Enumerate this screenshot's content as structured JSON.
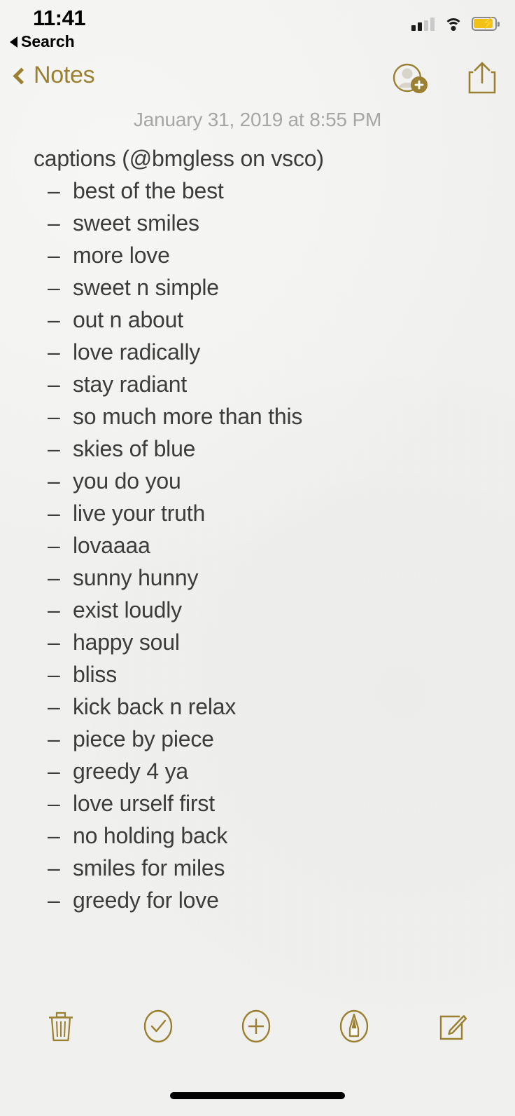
{
  "status_bar": {
    "time": "11:41",
    "back_app_label": "Search",
    "back_arrow_icon": "triangle-left-icon",
    "signal_icon": "cellular-signal-icon",
    "signal_bars_filled": 2,
    "signal_bars_total": 4,
    "wifi_icon": "wifi-icon",
    "battery_icon": "battery-charging-icon",
    "battery_charging": true,
    "battery_color": "#f2c115"
  },
  "nav_bar": {
    "back_label": "Notes",
    "back_icon": "chevron-left-icon",
    "add_people_icon": "add-person-icon",
    "share_icon": "share-icon",
    "accent_color": "#9c8032"
  },
  "note": {
    "date": "January 31, 2019 at 8:55 PM",
    "title": "captions (@bmgless on vsco)",
    "bullet": "–",
    "items": [
      "best of the best",
      "sweet smiles",
      "more love",
      "sweet n simple",
      "out n about",
      "love radically",
      "stay radiant",
      "so much more than this",
      "skies of blue",
      "you do you",
      "live your truth",
      "lovaaaa",
      "sunny hunny",
      "exist loudly",
      "happy soul",
      "bliss",
      "kick back n relax",
      "piece by piece",
      "greedy 4 ya",
      "love urself first",
      "no holding back",
      "smiles for miles",
      "greedy for love"
    ],
    "text_color": "#3c3c3c",
    "date_color": "#a6a6a6"
  },
  "toolbar": {
    "delete_icon": "trash-icon",
    "checklist_icon": "checkmark-circle-icon",
    "add_attachment_icon": "plus-circle-icon",
    "markup_icon": "markup-pen-circle-icon",
    "compose_icon": "compose-icon"
  }
}
